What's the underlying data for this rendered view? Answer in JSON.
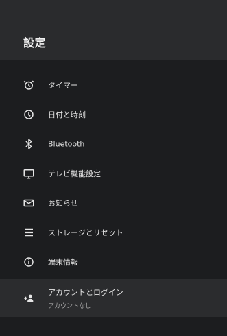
{
  "header": {
    "title": "設定"
  },
  "menu": {
    "items": [
      {
        "label": "タイマー",
        "icon": "alarm-icon"
      },
      {
        "label": "日付と時刻",
        "icon": "clock-icon"
      },
      {
        "label": "Bluetooth",
        "icon": "bluetooth-icon"
      },
      {
        "label": "テレビ機能設定",
        "icon": "tv-icon"
      },
      {
        "label": "お知らせ",
        "icon": "mail-icon"
      },
      {
        "label": "ストレージとリセット",
        "icon": "storage-icon"
      },
      {
        "label": "端末情報",
        "icon": "info-icon"
      }
    ],
    "account": {
      "label": "アカウントとログイン",
      "sublabel": "アカウントなし",
      "icon": "add-person-icon"
    }
  },
  "colors": {
    "background": "#1c1d1f",
    "header": "#2a2b2d",
    "selected_row": "#2b2c2e",
    "text": "#e3e3e3",
    "subtext": "#a8a8a8"
  }
}
